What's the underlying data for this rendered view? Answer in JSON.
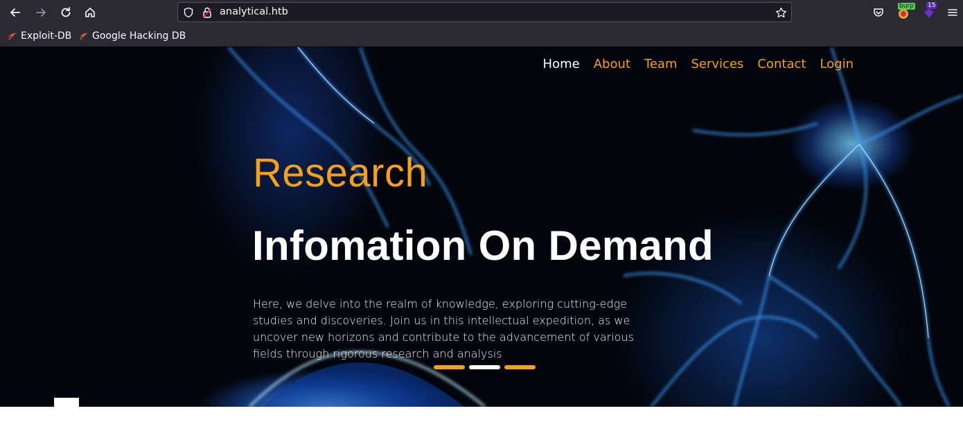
{
  "browser": {
    "url": "analytical.htb",
    "bookmarks": [
      {
        "label": "Exploit-DB",
        "icon": "exploitdb-icon"
      },
      {
        "label": "Google Hacking DB",
        "icon": "ghdb-icon"
      }
    ],
    "extensions": {
      "burp_badge": "burp",
      "ublock_count": "15"
    }
  },
  "site": {
    "nav": [
      "Home",
      "About",
      "Team",
      "Services",
      "Contact",
      "Login"
    ],
    "active_nav": "Home",
    "hero": {
      "kicker": "Research",
      "title": "Infomation On Demand",
      "description": "Here, we delve into the realm of knowledge, exploring cutting-edge studies and discoveries. Join us in this intellectual expedition, as we uncover new horizons and contribute to the advancement of various fields through rigorous research and analysis",
      "carousel_active_index": 1,
      "carousel_count": 3
    },
    "colors": {
      "accent": "#f5a01b",
      "hero_bg": "#02050c",
      "text": "#ffffff"
    }
  }
}
